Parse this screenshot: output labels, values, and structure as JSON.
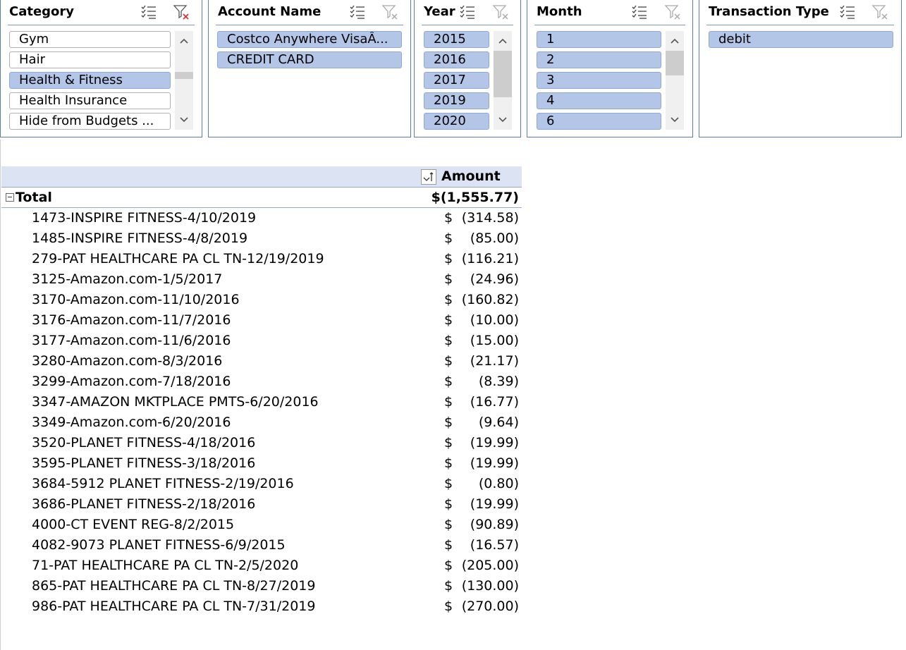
{
  "slicers": {
    "category": {
      "title": "Category",
      "items": [
        {
          "label": "Gym",
          "selected": false
        },
        {
          "label": "Hair",
          "selected": false
        },
        {
          "label": "Health & Fitness",
          "selected": true
        },
        {
          "label": "Health Insurance",
          "selected": false
        },
        {
          "label": "Hide from Budgets ...",
          "selected": false
        }
      ]
    },
    "account": {
      "title": "Account Name",
      "items": [
        {
          "label": "Costco Anywhere VisaÂ...",
          "selected": true
        },
        {
          "label": "CREDIT CARD",
          "selected": true
        }
      ]
    },
    "year": {
      "title": "Year",
      "items": [
        {
          "label": "2015",
          "selected": true
        },
        {
          "label": "2016",
          "selected": true
        },
        {
          "label": "2017",
          "selected": true
        },
        {
          "label": "2019",
          "selected": true
        },
        {
          "label": "2020",
          "selected": true
        }
      ]
    },
    "month": {
      "title": "Month",
      "items": [
        {
          "label": "1",
          "selected": true
        },
        {
          "label": "2",
          "selected": true
        },
        {
          "label": "3",
          "selected": true
        },
        {
          "label": "4",
          "selected": true
        },
        {
          "label": "6",
          "selected": true
        }
      ]
    },
    "type": {
      "title": "Transaction Type",
      "items": [
        {
          "label": "debit",
          "selected": true
        }
      ]
    }
  },
  "pivot": {
    "value_header": "Amount",
    "total_label": "Total",
    "total_value": "$(1,555.77)",
    "currency_symbol": "$",
    "rows": [
      {
        "label": "1473-INSPIRE FITNESS-4/10/2019",
        "value": "(314.58)"
      },
      {
        "label": "1485-INSPIRE FITNESS-4/8/2019",
        "value": "(85.00)"
      },
      {
        "label": "279-PAT HEALTHCARE PA CL TN-12/19/2019",
        "value": "(116.21)"
      },
      {
        "label": "3125-Amazon.com-1/5/2017",
        "value": "(24.96)"
      },
      {
        "label": "3170-Amazon.com-11/10/2016",
        "value": "(160.82)"
      },
      {
        "label": "3176-Amazon.com-11/7/2016",
        "value": "(10.00)"
      },
      {
        "label": "3177-Amazon.com-11/6/2016",
        "value": "(15.00)"
      },
      {
        "label": "3280-Amazon.com-8/3/2016",
        "value": "(21.17)"
      },
      {
        "label": "3299-Amazon.com-7/18/2016",
        "value": "(8.39)"
      },
      {
        "label": "3347-AMAZON MKTPLACE PMTS-6/20/2016",
        "value": "(16.77)"
      },
      {
        "label": "3349-Amazon.com-6/20/2016",
        "value": "(9.64)"
      },
      {
        "label": "3520-PLANET FITNESS-4/18/2016",
        "value": "(19.99)"
      },
      {
        "label": "3595-PLANET FITNESS-3/18/2016",
        "value": "(19.99)"
      },
      {
        "label": "3684-5912 PLANET FITNESS-2/19/2016",
        "value": "(0.80)"
      },
      {
        "label": "3686-PLANET FITNESS-2/18/2016",
        "value": "(19.99)"
      },
      {
        "label": "4000-CT EVENT REG-8/2/2015",
        "value": "(90.89)"
      },
      {
        "label": "4082-9073 PLANET FITNESS-6/9/2015",
        "value": "(16.57)"
      },
      {
        "label": "71-PAT HEALTHCARE PA CL TN-2/5/2020",
        "value": "(205.00)"
      },
      {
        "label": "865-PAT HEALTHCARE PA CL TN-8/27/2019",
        "value": "(130.00)"
      },
      {
        "label": "986-PAT HEALTHCARE PA CL TN-7/31/2019",
        "value": "(270.00)"
      }
    ]
  },
  "icons": {
    "multi_select": "multi-select-icon",
    "clear_filter": "clear-filter-icon",
    "scroll_up": "chevron-up-icon",
    "scroll_down": "chevron-down-icon",
    "sort": "sort-icon",
    "collapse": "collapse-icon"
  },
  "colors": {
    "selected_item": "#b4c6e7",
    "slicer_border": "#5b7fb0",
    "pivot_header": "#dce3f3",
    "clear_filter_active": "#e03030"
  }
}
